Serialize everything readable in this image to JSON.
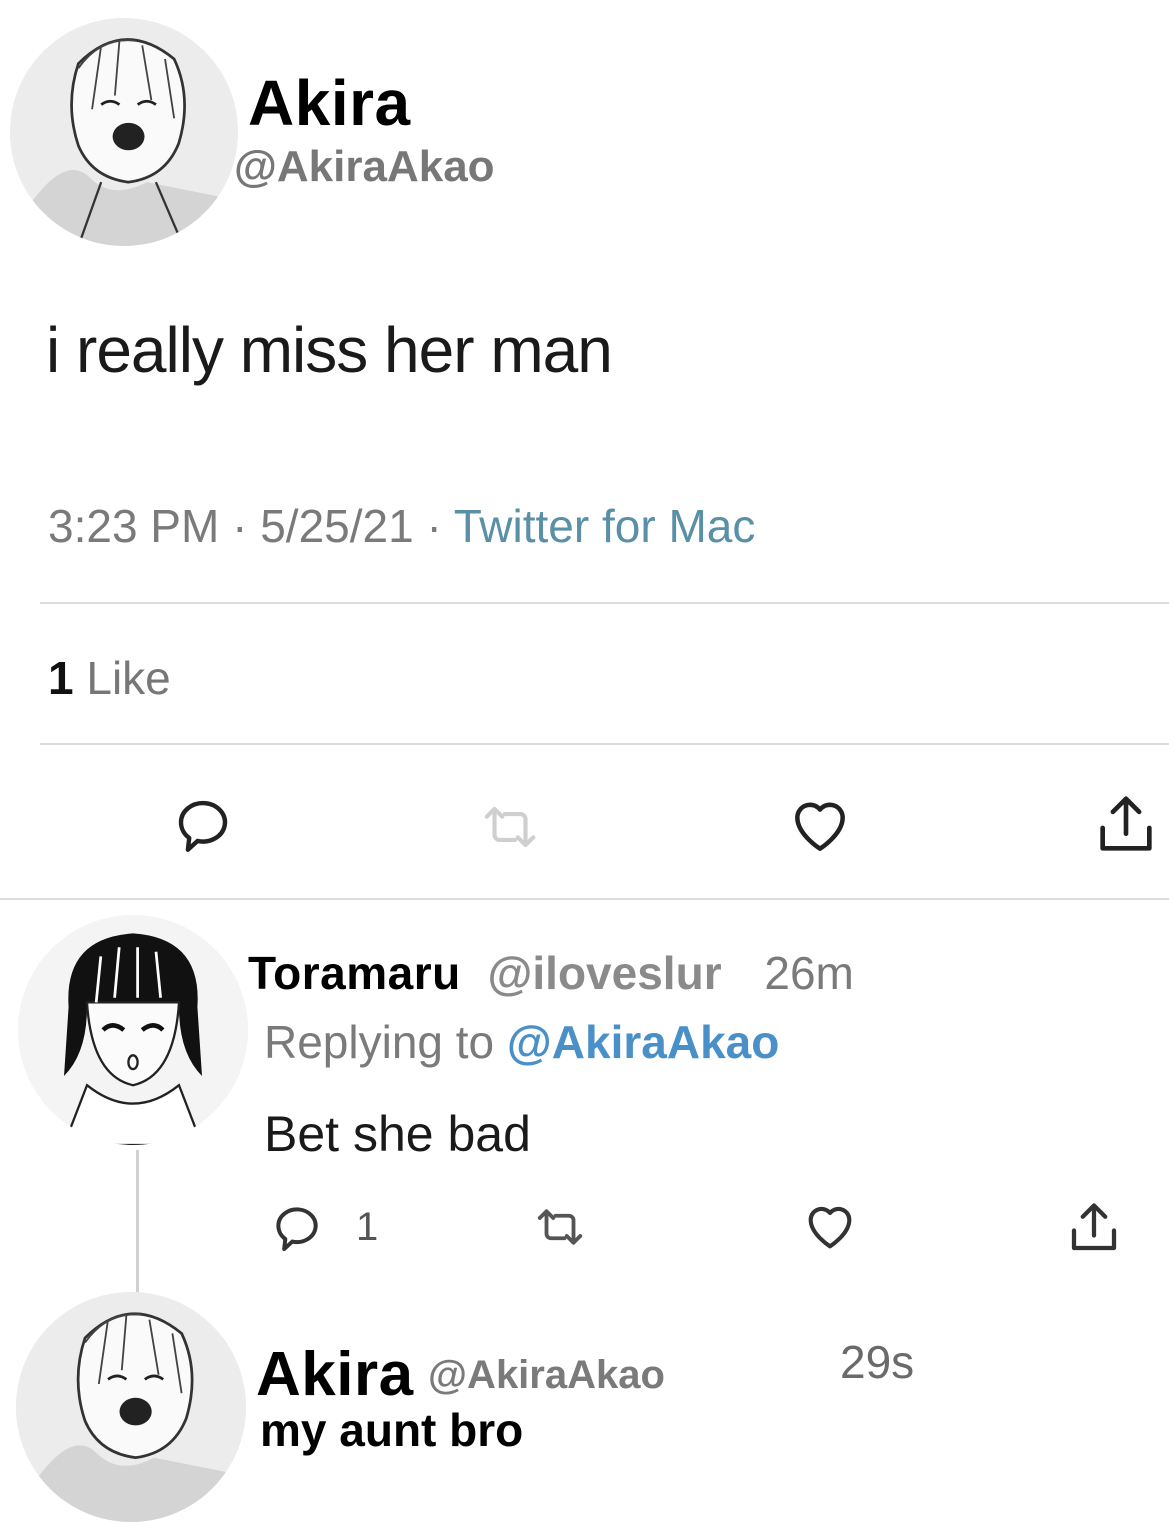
{
  "main_tweet": {
    "author_name": "Akira",
    "author_handle": "@AkiraAkao",
    "text": "i really miss her man",
    "time": "3:23 PM",
    "date": "5/25/21",
    "separator": "·",
    "client": "Twitter for Mac",
    "likes_count": "1",
    "likes_label": "Like",
    "actions": [
      "reply-icon",
      "retweet-icon",
      "like-icon",
      "share-icon"
    ]
  },
  "reply": {
    "author_name": "Toramaru",
    "author_handle": "@iloveslur",
    "age": "26m",
    "replying_prefix": "Replying to",
    "replying_handle": "@AkiraAkao",
    "text": "Bet she bad",
    "reply_count": "1",
    "actions": [
      "reply-icon",
      "retweet-icon",
      "like-icon",
      "share-icon"
    ]
  },
  "second_reply": {
    "author_name": "Akira",
    "author_handle": "@AkiraAkao",
    "age": "29s",
    "text": "my aunt bro"
  },
  "colors": {
    "link_blue": "#4a90c8",
    "client_blue": "#5a8fa8",
    "meta_grey": "#7a7a7a",
    "divider": "#dcdcdc"
  }
}
